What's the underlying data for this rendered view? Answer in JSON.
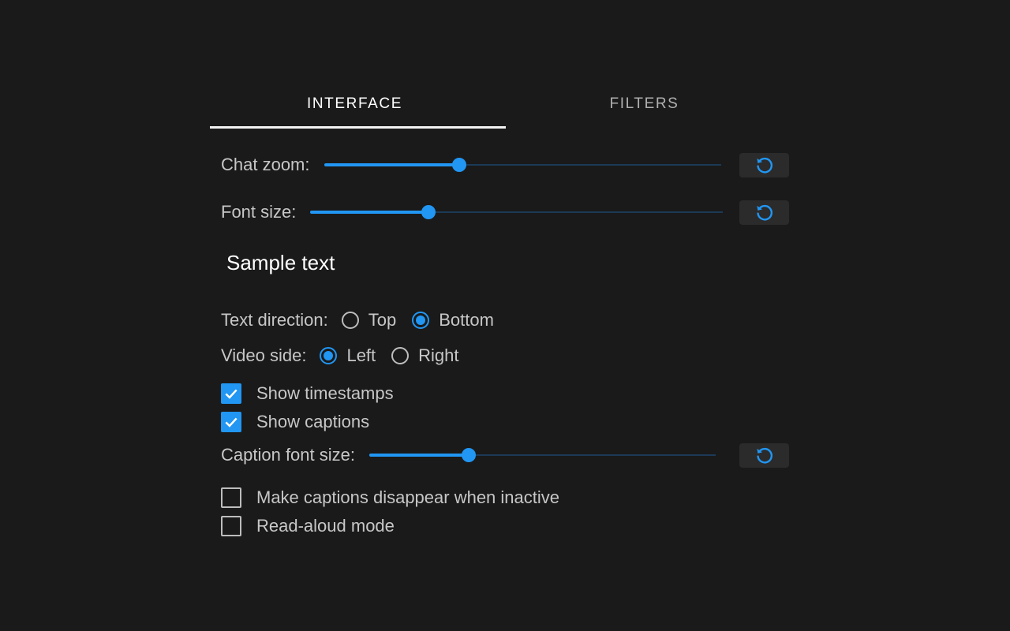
{
  "tabs": [
    {
      "label": "INTERFACE",
      "active": true
    },
    {
      "label": "FILTERS",
      "active": false
    }
  ],
  "chat_zoom": {
    "label": "Chat zoom:",
    "value_fraction": 0.34
  },
  "font_size": {
    "label": "Font size:",
    "value_fraction": 0.286
  },
  "sample_text": "Sample text",
  "text_direction": {
    "label": "Text direction:",
    "options": [
      {
        "label": "Top",
        "selected": false
      },
      {
        "label": "Bottom",
        "selected": true
      }
    ]
  },
  "video_side": {
    "label": "Video side:",
    "options": [
      {
        "label": "Left",
        "selected": true
      },
      {
        "label": "Right",
        "selected": false
      }
    ]
  },
  "checkboxes_top": [
    {
      "label": "Show timestamps",
      "checked": true
    },
    {
      "label": "Show captions",
      "checked": true
    }
  ],
  "caption_font_size": {
    "label": "Caption font size:",
    "value_fraction": 0.286
  },
  "checkboxes_bottom": [
    {
      "label": "Make captions disappear when inactive",
      "checked": false
    },
    {
      "label": "Read-aloud mode",
      "checked": false
    }
  ],
  "icons": {
    "reset": "reset-icon",
    "check": "checkmark-icon"
  },
  "colors": {
    "accent": "#2196f3",
    "background": "#1a1a1a",
    "track": "#1c3a57"
  }
}
